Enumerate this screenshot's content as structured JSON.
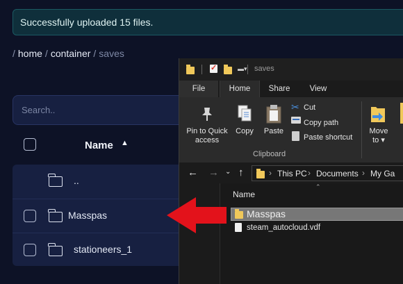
{
  "notification": {
    "text": "Successfully uploaded 15 files."
  },
  "breadcrumb": {
    "root_sep": "/",
    "home": "home",
    "sep": "/",
    "container": "container",
    "current": "saves"
  },
  "search": {
    "placeholder": "Search.."
  },
  "table": {
    "name_header": "Name",
    "sort_icon": "sort-ascending-icon",
    "rows": [
      {
        "name": "..",
        "icon": "folder-icon"
      },
      {
        "name": "Masspas",
        "icon": "folder-icon"
      },
      {
        "name": "stationeers_1",
        "icon": "folder-icon"
      }
    ]
  },
  "explorer": {
    "title": "saves",
    "tabs": [
      "File",
      "Home",
      "Share",
      "View"
    ],
    "ribbon": {
      "pin": "Pin to Quick access",
      "pin_line1": "Pin to Quick",
      "pin_line2": "access",
      "copy": "Copy",
      "paste": "Paste",
      "cut": "Cut",
      "copy_path": "Copy path",
      "paste_shortcut": "Paste shortcut",
      "move_to": "Move to",
      "move_line1": "Move",
      "move_line2": "to ▾",
      "group": "Clipboard"
    },
    "address": [
      "This PC",
      "Documents",
      "My Ga"
    ],
    "column_name": "Name",
    "items": [
      {
        "name": "Masspas",
        "selected": true
      },
      {
        "name": "steam_autocloud.vdf",
        "selected": false
      }
    ]
  },
  "colors": {
    "arrow": "#e3121b",
    "background": "#0d1226",
    "notice_bg": "#0f2f3b"
  }
}
